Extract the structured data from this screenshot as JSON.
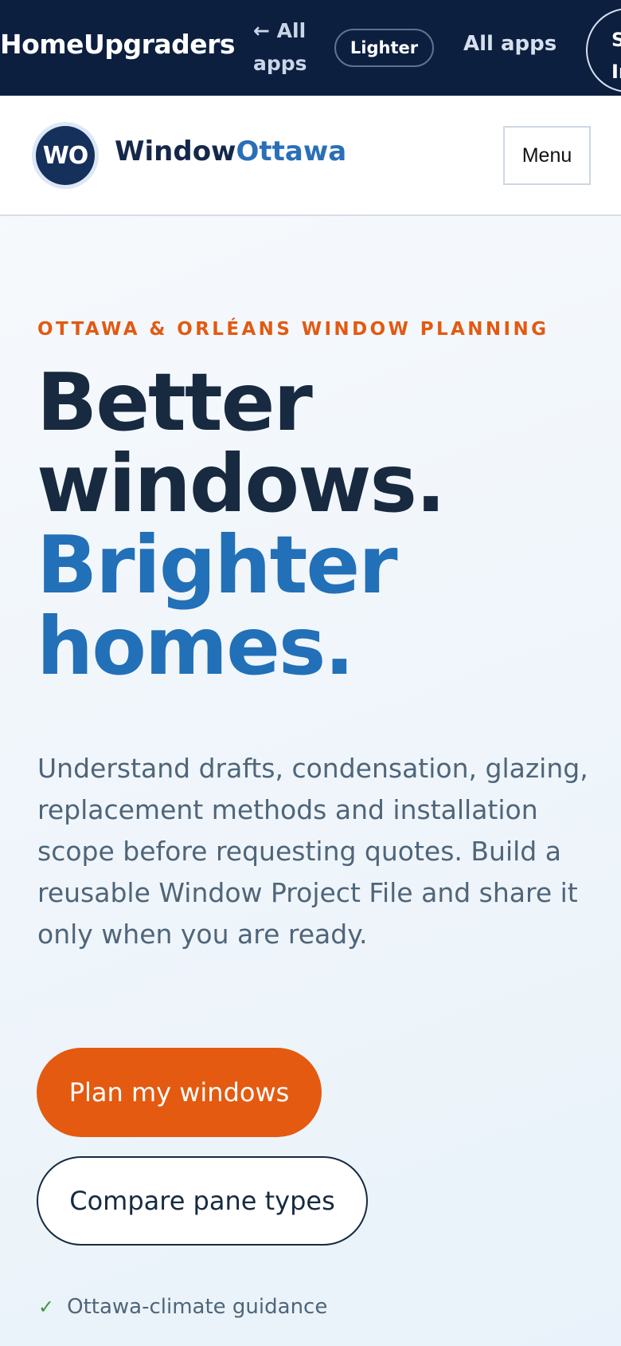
{
  "topbar": {
    "brand": "HomeUpgraders",
    "back_link": "← All apps",
    "theme_toggle": "Lighter",
    "all_apps": "All apps",
    "sign_in": "Sign In"
  },
  "site_header": {
    "logo_initials": "WO",
    "name_part1": "Window",
    "name_part2": "Ottawa",
    "menu_label": "Menu"
  },
  "hero": {
    "eyebrow": "OTTAWA & ORLÉANS WINDOW PLANNING",
    "headline_line1": "Better",
    "headline_line2": "windows.",
    "headline_line3": "Brighter",
    "headline_line4": "homes.",
    "intro": "Understand drafts, condensation, glazing, replacement methods and installation scope before requesting quotes. Build a reusable Window Project File and share it only when you are ready.",
    "primary_cta": "Plan my windows",
    "secondary_cta": "Compare pane types",
    "feature_check": "✓",
    "feature_text": "Ottawa-climate guidance"
  },
  "colors": {
    "topbar_bg": "#0d1f3f",
    "accent_orange": "#e45a10",
    "accent_blue": "#2270b8",
    "heading_dark": "#172a40"
  }
}
